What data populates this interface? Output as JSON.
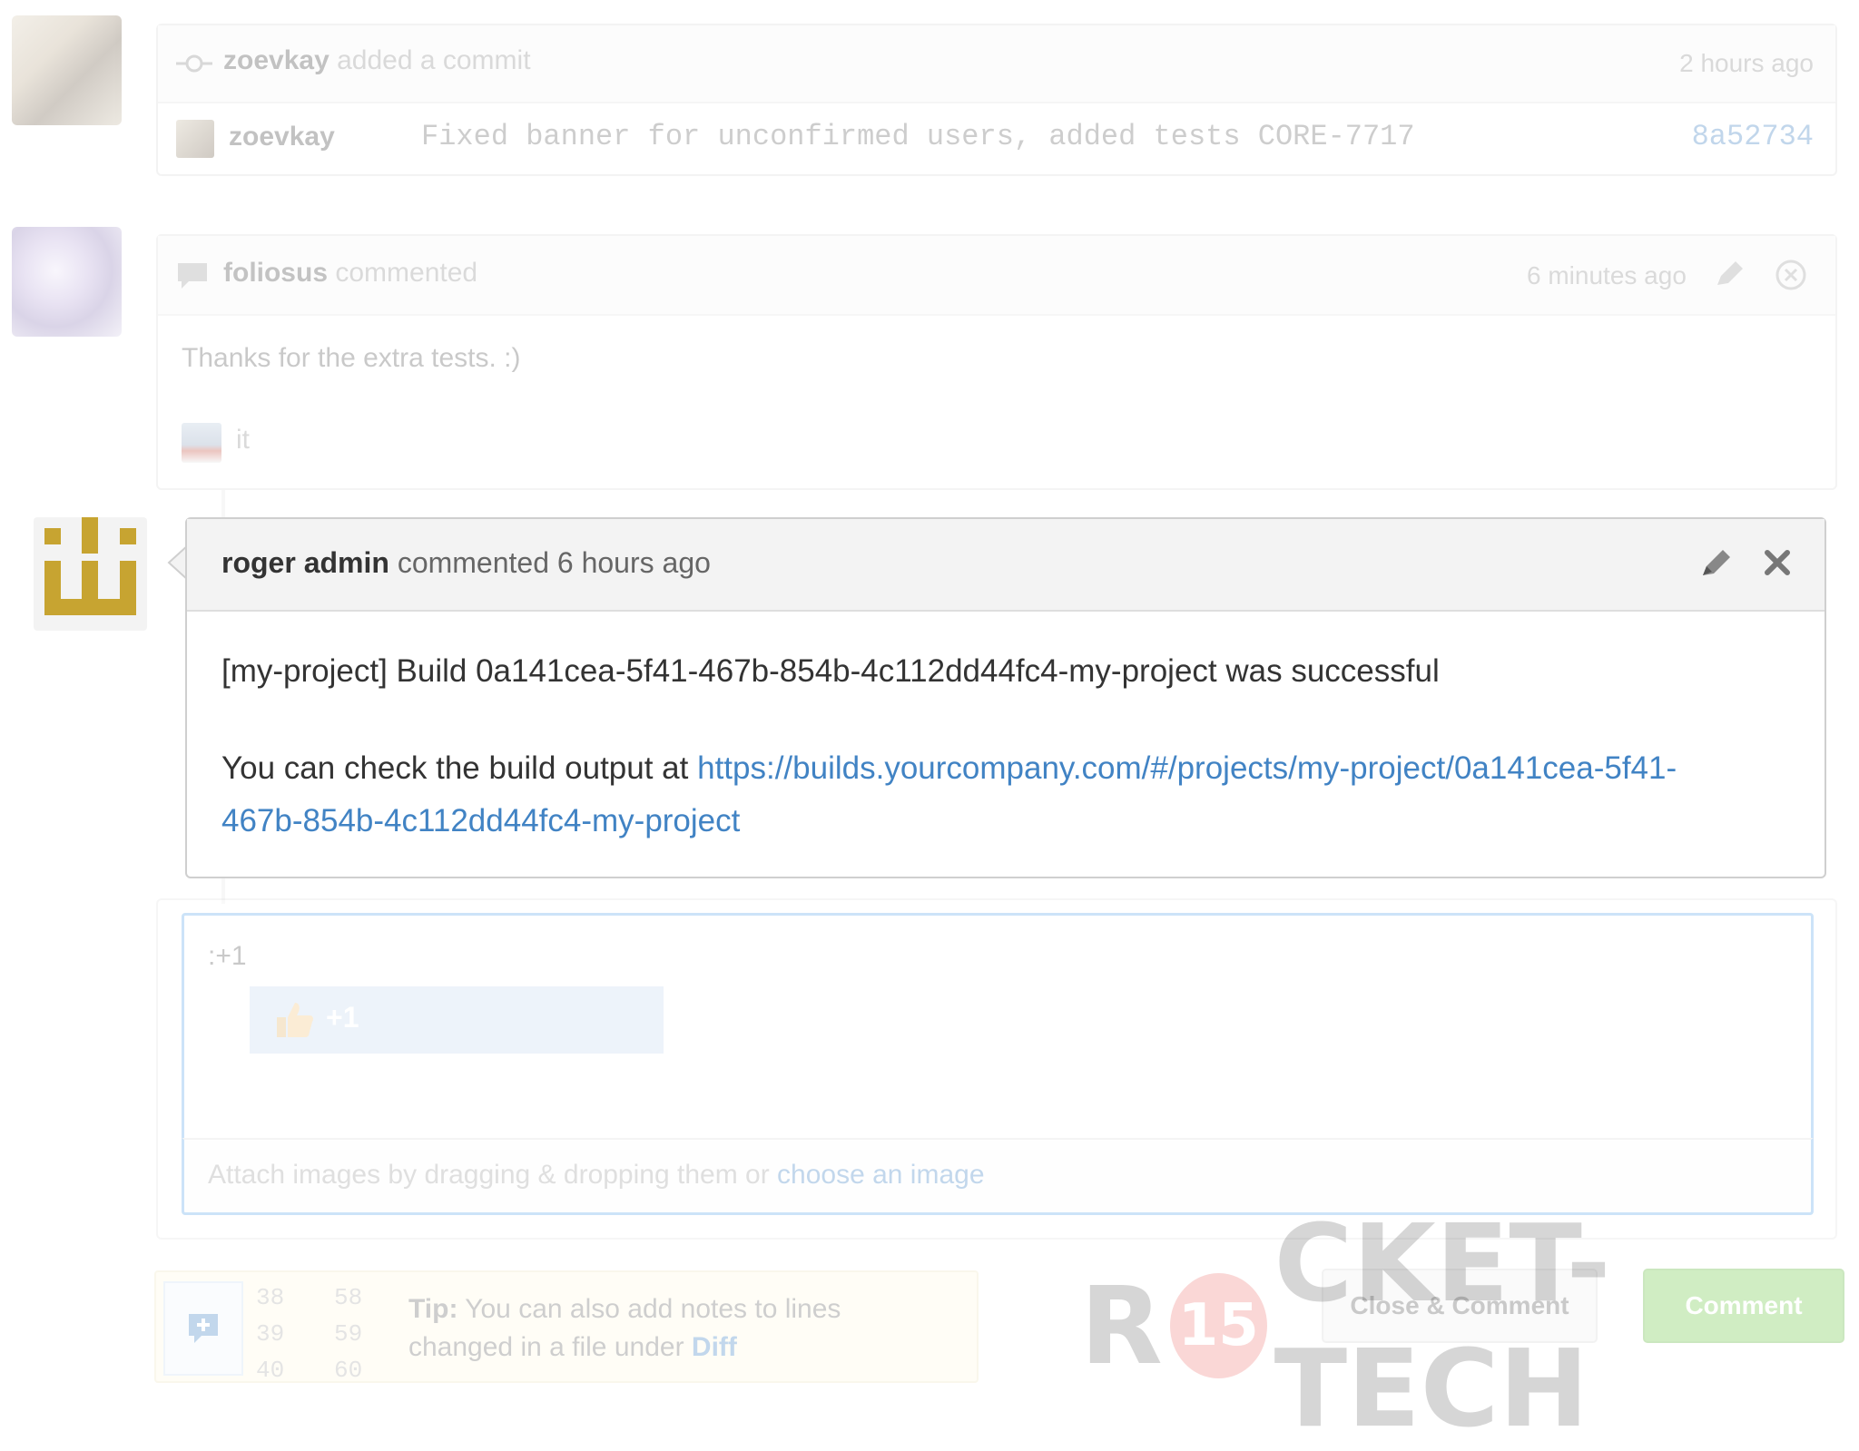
{
  "commit_event": {
    "actor": "zoevkay",
    "action": "added a commit",
    "time": "2 hours ago",
    "commit_author": "zoevkay",
    "commit_message": "Fixed banner for unconfirmed users, added tests CORE-7717",
    "commit_sha": "8a52734"
  },
  "comment_1": {
    "author": "foliosus",
    "action": "commented",
    "time": "6 minutes ago",
    "body": "Thanks for the extra tests. :)",
    "attachment_text": "it"
  },
  "comment_2": {
    "author": "roger admin",
    "action": "commented 6 hours ago",
    "line1": "[my-project] Build 0a141cea-5f41-467b-854b-4c112dd44fc4-my-project was successful",
    "line2_prefix": "You can check the build output at ",
    "link_part1": "https://builds.yourcompany.com/#/projects/my-project/0a141cea-5f41-",
    "link_part2": "467b-854b-4c112dd44fc4-my-project"
  },
  "composer": {
    "text": ":+1",
    "suggestion_label": "+1",
    "attach_text": "Attach images by dragging & dropping them or ",
    "attach_link": "choose an image"
  },
  "tip": {
    "label": "Tip:",
    "text_line1": " You can also add notes to lines",
    "text_line2": "changed in a file under ",
    "link": "Diff",
    "line_numbers_left": [
      "38",
      "39",
      "40"
    ],
    "line_numbers_right": [
      "58",
      "59",
      "60"
    ]
  },
  "actions": {
    "close_comment_label": "Close & Comment",
    "comment_label": "Comment"
  },
  "watermark": {
    "text_left": "R",
    "badge": "15",
    "text_right": "CKET-TECH"
  },
  "colors": {
    "link": "#4183c4",
    "identicon": "#c7a431",
    "comment_button": "#6cc644",
    "suggestion_bg": "#c7d9ef"
  }
}
